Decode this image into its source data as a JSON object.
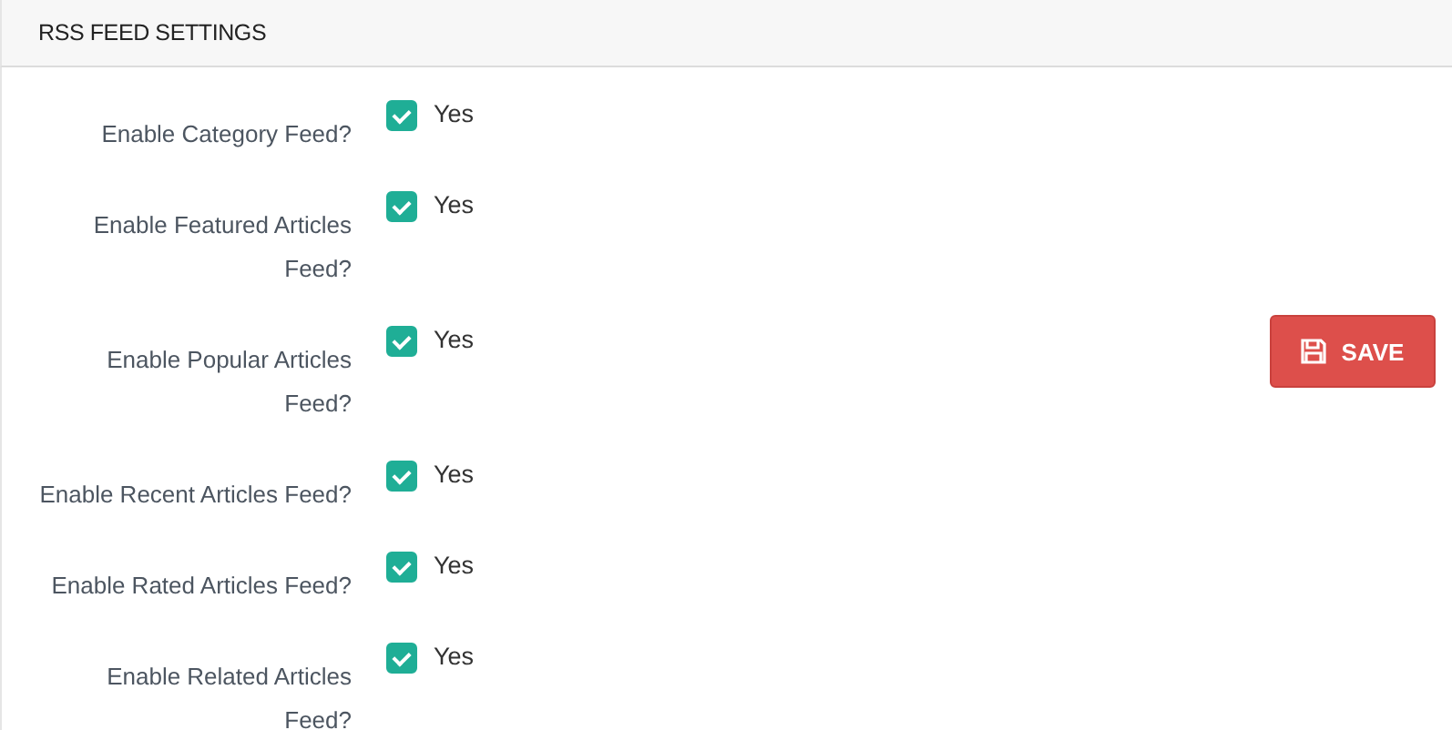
{
  "panel": {
    "title": "RSS FEED SETTINGS"
  },
  "settings": [
    {
      "label": "Enable Category Feed?",
      "checked": true,
      "option": "Yes"
    },
    {
      "label": "Enable Featured Articles Feed?",
      "checked": true,
      "option": "Yes"
    },
    {
      "label": "Enable Popular Articles Feed?",
      "checked": true,
      "option": "Yes"
    },
    {
      "label": "Enable Recent Articles Feed?",
      "checked": true,
      "option": "Yes"
    },
    {
      "label": "Enable Rated Articles Feed?",
      "checked": true,
      "option": "Yes"
    },
    {
      "label": "Enable Related Articles Feed?",
      "checked": true,
      "option": "Yes"
    }
  ],
  "save_button": {
    "label": "SAVE"
  }
}
